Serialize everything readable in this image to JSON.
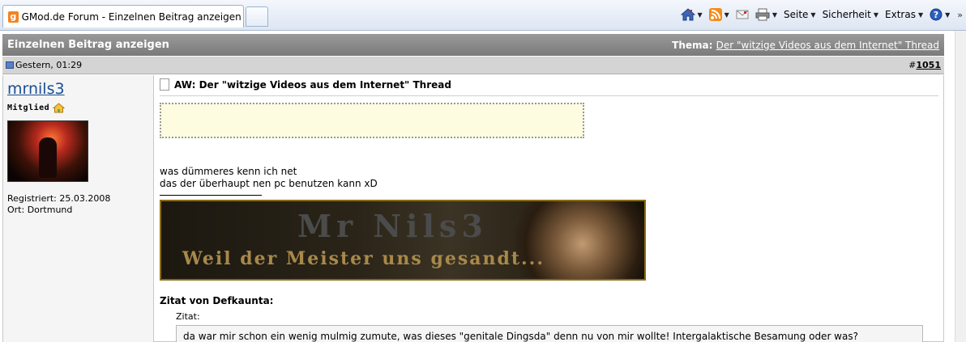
{
  "browser": {
    "tab_title": "GMod.de Forum - Einzelnen Beitrag anzeigen - D...",
    "favicon_letter": "g",
    "commands": {
      "seite": "Seite",
      "sicherheit": "Sicherheit",
      "extras": "Extras"
    },
    "icons": [
      "home-icon",
      "rss-feed-icon",
      "mail-icon",
      "print-icon",
      "help-icon"
    ],
    "overflow": "»"
  },
  "forum": {
    "header_title": "Einzelnen Beitrag anzeigen",
    "thema_label": "Thema:",
    "thema_link": "Der \"witzige Videos aus dem Internet\" Thread",
    "post_date": "Gestern, 01:29",
    "post_number_prefix": "#",
    "post_number": "1051",
    "user": {
      "name": "mrnils3",
      "rank": "Mitglied",
      "registered": "Registriert: 25.03.2008",
      "location": "Ort: Dortmund"
    },
    "post": {
      "title": "AW: Der \"witzige Videos aus dem Internet\" Thread",
      "line1": "was dümmeres kenn ich net",
      "line2": "das der überhaupt nen pc benutzen kann xD",
      "banner_top": "Mr Nils3",
      "banner_bottom": "Weil der Meister uns gesandt...",
      "quote_from": "Zitat von Defkaunta:",
      "zitat_label": "Zitat:",
      "quote_text": "da war mir schon ein wenig mulmig zumute, was dieses \"genitale Dingsda\" denn nu von mir wollte! Intergalaktische Besamung oder was?"
    }
  },
  "colors": {
    "header_bg": "#888888",
    "postbar_bg": "#d4d4d4",
    "link": "#1a4e96",
    "ad_bg": "#fdfce0"
  }
}
